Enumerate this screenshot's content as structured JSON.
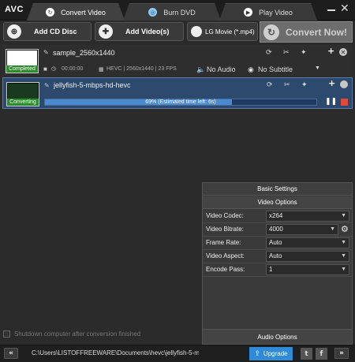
{
  "app": {
    "logo": "AVC"
  },
  "tabs": [
    {
      "label": "Convert Video",
      "icon": "convert-video-icon"
    },
    {
      "label": "Burn DVD",
      "icon": "burn-dvd-icon"
    },
    {
      "label": "Play Video",
      "icon": "play-video-icon"
    }
  ],
  "toolbar": {
    "add_cd_label": "Add CD Disc",
    "add_videos_label": "Add Video(s)",
    "profile_label": "LG Movie (*.mp4)",
    "convert_now_label": "Convert Now!"
  },
  "files": [
    {
      "name": "sample_2560x1440",
      "status": "Completed",
      "duration": "00:00:00",
      "info": "HEVC | 2560x1440 | 23 FPS",
      "audio": "No Audio",
      "subtitle": "No Subtitle"
    },
    {
      "name": "jellyfish-5-mbps-hd-hevc",
      "status": "Converting",
      "progress_percent": 69,
      "progress_text": "69% (Estimated time left: 6s)"
    }
  ],
  "settings": {
    "basic_header": "Basic Settings",
    "video_header": "Video Options",
    "rows": [
      {
        "label": "Video Codec:",
        "value": "x264"
      },
      {
        "label": "Video Bitrate:",
        "value": "4000"
      },
      {
        "label": "Frame Rate:",
        "value": "Auto"
      },
      {
        "label": "Video Aspect:",
        "value": "Auto"
      },
      {
        "label": "Encode Pass:",
        "value": "1"
      }
    ],
    "audio_header": "Audio Options"
  },
  "shutdown_label": "Shutdown computer after conversion finished",
  "statusbar": {
    "path": "C:\\Users\\LISTOFFREEWARE\\Documents\\hevc\\jellyfish-5-m",
    "upgrade_label": "Upgrade",
    "twitter": "t",
    "facebook": "f"
  },
  "colors": {
    "accent_blue": "#2f8ad8",
    "selected_row": "#2c4a6e",
    "stop_red": "#e04a3a",
    "completed_green": "#2d8a2d"
  }
}
